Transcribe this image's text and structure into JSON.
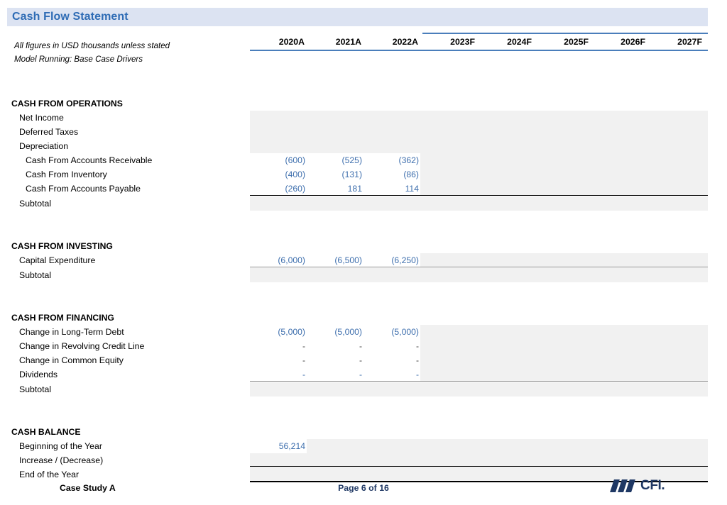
{
  "header": {
    "title": "Cash Flow Statement",
    "note_line_1": "All figures in USD thousands unless stated",
    "note_line_2": "Model Running: Base Case Drivers",
    "accent_color": "#2f6cb5",
    "title_bar_color": "#dce3f2",
    "rule_color": "#4a7ebb"
  },
  "columns": [
    {
      "label": "2020A",
      "type": "actual"
    },
    {
      "label": "2021A",
      "type": "actual"
    },
    {
      "label": "2022A",
      "type": "actual"
    },
    {
      "label": "2023F",
      "type": "forecast"
    },
    {
      "label": "2024F",
      "type": "forecast"
    },
    {
      "label": "2025F",
      "type": "forecast"
    },
    {
      "label": "2026F",
      "type": "forecast"
    },
    {
      "label": "2027F",
      "type": "forecast"
    }
  ],
  "sections": [
    {
      "title": "CASH FROM OPERATIONS",
      "rows": [
        {
          "label": "Net Income",
          "indent": 1,
          "values": [
            "",
            "",
            "",
            "",
            "",
            "",
            "",
            ""
          ]
        },
        {
          "label": "Deferred Taxes",
          "indent": 1,
          "values": [
            "",
            "",
            "",
            "",
            "",
            "",
            "",
            ""
          ]
        },
        {
          "label": "Depreciation",
          "indent": 1,
          "values": [
            "",
            "",
            "",
            "",
            "",
            "",
            "",
            ""
          ]
        },
        {
          "label": "Cash From Accounts Receivable",
          "indent": 2,
          "values": [
            "(600)",
            "(525)",
            "(362)",
            "",
            "",
            "",
            "",
            ""
          ]
        },
        {
          "label": "Cash From Inventory",
          "indent": 2,
          "values": [
            "(400)",
            "(131)",
            "(86)",
            "",
            "",
            "",
            "",
            ""
          ]
        },
        {
          "label": "Cash From Accounts Payable",
          "indent": 2,
          "values": [
            "(260)",
            "181",
            "114",
            "",
            "",
            "",
            "",
            ""
          ]
        },
        {
          "label": "Subtotal",
          "indent": 1,
          "values": [
            "",
            "",
            "",
            "",
            "",
            "",
            "",
            ""
          ]
        }
      ]
    },
    {
      "title": "CASH FROM INVESTING",
      "rows": [
        {
          "label": "Capital Expenditure",
          "indent": 1,
          "values": [
            "(6,000)",
            "(6,500)",
            "(6,250)",
            "",
            "",
            "",
            "",
            ""
          ]
        },
        {
          "label": "Subtotal",
          "indent": 1,
          "values": [
            "",
            "",
            "",
            "",
            "",
            "",
            "",
            ""
          ]
        }
      ]
    },
    {
      "title": "CASH FROM FINANCING",
      "rows": [
        {
          "label": "Change in Long-Term Debt",
          "indent": 1,
          "values": [
            "(5,000)",
            "(5,000)",
            "(5,000)",
            "",
            "",
            "",
            "",
            ""
          ]
        },
        {
          "label": "Change in Revolving Credit Line",
          "indent": 1,
          "values": [
            "-",
            "-",
            "-",
            "",
            "",
            "",
            "",
            ""
          ]
        },
        {
          "label": "Change in Common Equity",
          "indent": 1,
          "values": [
            "-",
            "-",
            "-",
            "",
            "",
            "",
            "",
            ""
          ]
        },
        {
          "label": "Dividends",
          "indent": 1,
          "values": [
            "-",
            "-",
            "-",
            "",
            "",
            "",
            "",
            ""
          ]
        },
        {
          "label": "Subtotal",
          "indent": 1,
          "values": [
            "",
            "",
            "",
            "",
            "",
            "",
            "",
            ""
          ]
        }
      ]
    },
    {
      "title": "CASH BALANCE",
      "rows": [
        {
          "label": "Beginning of the Year",
          "indent": 1,
          "values": [
            "56,214",
            "",
            "",
            "",
            "",
            "",
            "",
            ""
          ]
        },
        {
          "label": "Increase / (Decrease)",
          "indent": 1,
          "values": [
            "",
            "",
            "",
            "",
            "",
            "",
            "",
            ""
          ]
        },
        {
          "label": "End of the Year",
          "indent": 1,
          "values": [
            "",
            "",
            "",
            "",
            "",
            "",
            "",
            ""
          ]
        }
      ]
    }
  ],
  "footer": {
    "case_label": "Case Study A",
    "page_label": "Page 6 of 16",
    "logo_text": "CFI.",
    "logo_color": "#1f3864"
  }
}
